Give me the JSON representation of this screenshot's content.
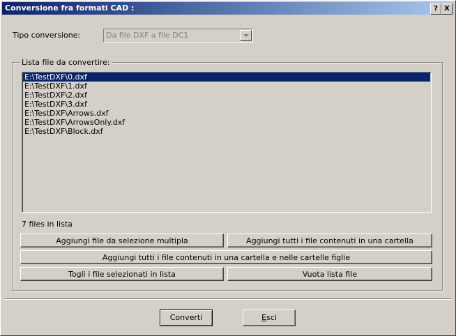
{
  "window": {
    "title": "Conversione fra formati CAD :",
    "help_button": "?",
    "close_button": "X"
  },
  "conversion": {
    "label": "Tipo conversione:",
    "selected": "Da file DXF a file DC1"
  },
  "file_list": {
    "group_label": "Lista file da convertire:",
    "items": [
      "E:\\TestDXF\\0.dxf",
      "E:\\TestDXF\\1.dxf",
      "E:\\TestDXF\\2.dxf",
      "E:\\TestDXF\\3.dxf",
      "E:\\TestDXF\\Arrows.dxf",
      "E:\\TestDXF\\ArrowsOnly.dxf",
      "E:\\TestDXF\\Block.dxf"
    ],
    "selected_index": 0,
    "count_text": "7 files in lista"
  },
  "buttons": {
    "add_multi": "Aggiungi file da selezione multipla",
    "add_folder": "Aggiungi tutti i file contenuti in una cartella",
    "add_folder_recursive": "Aggiungi tutti i file contenuti in una cartella e nelle cartelle figlie",
    "remove_selected": "Togli i file selezionati in lista",
    "clear_list": "Vuota lista file",
    "convert": "Converti",
    "exit_first": "E",
    "exit_rest": "sci"
  }
}
